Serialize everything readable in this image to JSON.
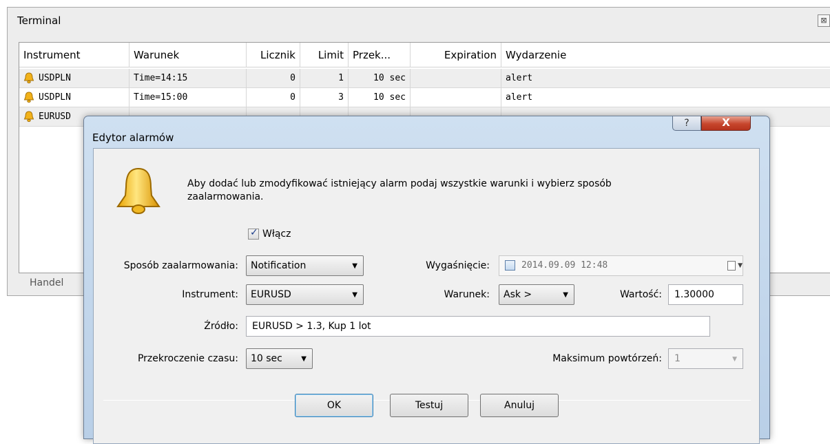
{
  "terminal": {
    "title": "Terminal",
    "close_glyph": "⊠",
    "columns": [
      "Instrument",
      "Warunek",
      "Licznik",
      "Limit",
      "Przek...",
      "Expiration",
      "Wydarzenie"
    ],
    "rows": [
      {
        "instrument": "USDPLN",
        "condition": "Time=14:15",
        "counter": "0",
        "limit": "1",
        "timeout": "10 sec",
        "expiration": "",
        "event": "alert"
      },
      {
        "instrument": "USDPLN",
        "condition": "Time=15:00",
        "counter": "0",
        "limit": "3",
        "timeout": "10 sec",
        "expiration": "",
        "event": "alert"
      },
      {
        "instrument": "EURUSD",
        "condition": "",
        "counter": "",
        "limit": "",
        "timeout": "",
        "expiration": "",
        "event": ""
      }
    ],
    "tab_label": "Handel",
    "bell_color": "#f2b21a"
  },
  "dialog": {
    "title": "Edytor alarmów",
    "help_glyph": "?",
    "close_glyph": "X",
    "intro_text": "Aby dodać lub zmodyfikować istniejący alarm podaj wszystkie warunki i wybierz sposób zaalarmowania.",
    "enable_label": "Włącz",
    "enable_checked": true,
    "check_glyph": "✓",
    "fields": {
      "method_label": "Sposób zaalarmowania:",
      "method_value": "Notification",
      "instrument_label": "Instrument:",
      "instrument_value": "EURUSD",
      "source_label": "Źródło:",
      "source_value": "EURUSD > 1.3, Kup 1 lot",
      "timeout_label": "Przekroczenie czasu:",
      "timeout_value": "10 sec",
      "expiry_label": "Wygaśnięcie:",
      "expiry_value": "2014.09.09 12:48",
      "condition_label": "Warunek:",
      "condition_value": "Ask >",
      "value_label": "Wartość:",
      "value_value": "1.30000",
      "max_repeat_label": "Maksimum powtórzeń:",
      "max_repeat_value": "1"
    },
    "dropdown_glyph": "▼",
    "buttons": {
      "ok": "OK",
      "test": "Testuj",
      "cancel": "Anuluj"
    }
  }
}
